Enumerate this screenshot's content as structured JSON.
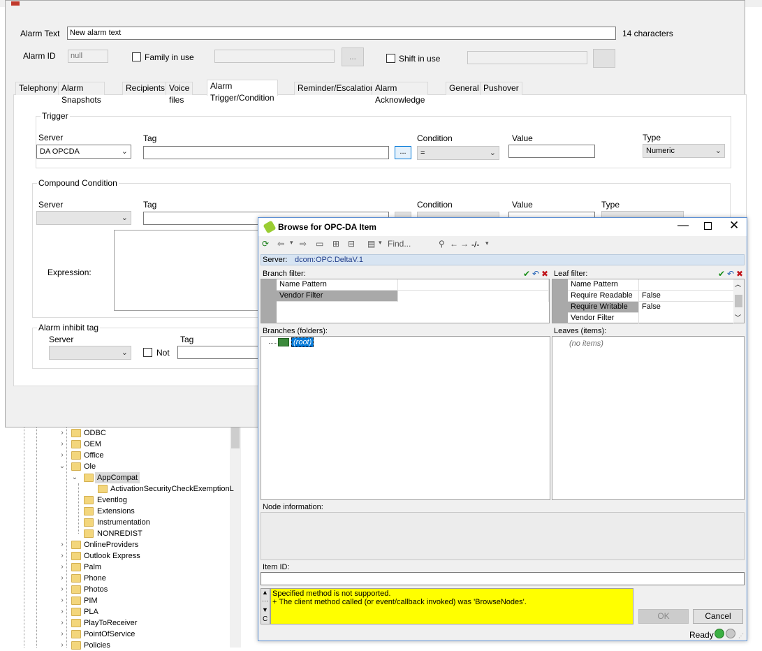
{
  "alarm": {
    "alarm_text_label": "Alarm Text",
    "alarm_text_value": "New alarm text",
    "char_count": "14 characters",
    "alarm_id_label": "Alarm ID",
    "alarm_id_value": "null",
    "family_label": "Family in use",
    "shift_label": "Shift in use",
    "ellipsis": "...",
    "tabs": [
      {
        "label": "Telephony"
      },
      {
        "label": "Alarm Snapshots"
      },
      {
        "label": "Recipients"
      },
      {
        "label": "Voice files"
      },
      {
        "label": "Alarm Trigger/Condition"
      },
      {
        "label": "Reminder/Escalation"
      },
      {
        "label": "Alarm Acknowledge"
      },
      {
        "label": "General"
      },
      {
        "label": "Pushover"
      }
    ],
    "trigger": {
      "title": "Trigger",
      "server_label": "Server",
      "server_value": "DA OPCDA",
      "tag_label": "Tag",
      "condition_label": "Condition",
      "condition_value": "=",
      "value_label": "Value",
      "type_label": "Type",
      "type_value": "Numeric"
    },
    "compound": {
      "title": "Compound Condition",
      "server_label": "Server",
      "tag_label": "Tag",
      "condition_label": "Condition",
      "value_label": "Value",
      "type_label": "Type",
      "expression_label": "Expression:"
    },
    "inhibit": {
      "title": "Alarm inhibit tag",
      "server_label": "Server",
      "not_label": "Not",
      "tag_label": "Tag"
    }
  },
  "tree": {
    "items": [
      {
        "label": "ODBC"
      },
      {
        "label": "OEM"
      },
      {
        "label": "Office"
      },
      {
        "label": "Ole"
      },
      {
        "label": "AppCompat"
      },
      {
        "label": "ActivationSecurityCheckExemptionL"
      },
      {
        "label": "Eventlog"
      },
      {
        "label": "Extensions"
      },
      {
        "label": "Instrumentation"
      },
      {
        "label": "NONREDIST"
      },
      {
        "label": "OnlineProviders"
      },
      {
        "label": "Outlook Express"
      },
      {
        "label": "Palm"
      },
      {
        "label": "Phone"
      },
      {
        "label": "Photos"
      },
      {
        "label": "PIM"
      },
      {
        "label": "PLA"
      },
      {
        "label": "PlayToReceiver"
      },
      {
        "label": "PointOfService"
      },
      {
        "label": "Policies"
      }
    ]
  },
  "browse": {
    "title": "Browse for OPC-DA Item",
    "find_placeholder": "Find...",
    "sep_label": "-/-",
    "server_label": "Server:",
    "server_value": "dcom:OPC.DeltaV.1",
    "branch_filter_label": "Branch filter:",
    "branch_rows": [
      {
        "name": "Name Pattern",
        "value": ""
      },
      {
        "name": "Vendor Filter",
        "value": ""
      }
    ],
    "leaf_filter_label": "Leaf filter:",
    "leaf_rows": [
      {
        "name": "Name Pattern",
        "value": ""
      },
      {
        "name": "Require Readable",
        "value": "False"
      },
      {
        "name": "Require Writable",
        "value": "False"
      },
      {
        "name": "Vendor Filter",
        "value": ""
      }
    ],
    "branches_label": "Branches (folders):",
    "root_label": "(root)",
    "leaves_label": "Leaves (items):",
    "no_items": "(no items)",
    "node_info_label": "Node information:",
    "item_id_label": "Item ID:",
    "error_line1": "Specified method is not supported.",
    "error_line2": "+ The client method called (or event/callback invoked) was 'BrowseNodes'.",
    "ok_label": "OK",
    "cancel_label": "Cancel",
    "status": "Ready",
    "side_c": "C"
  }
}
